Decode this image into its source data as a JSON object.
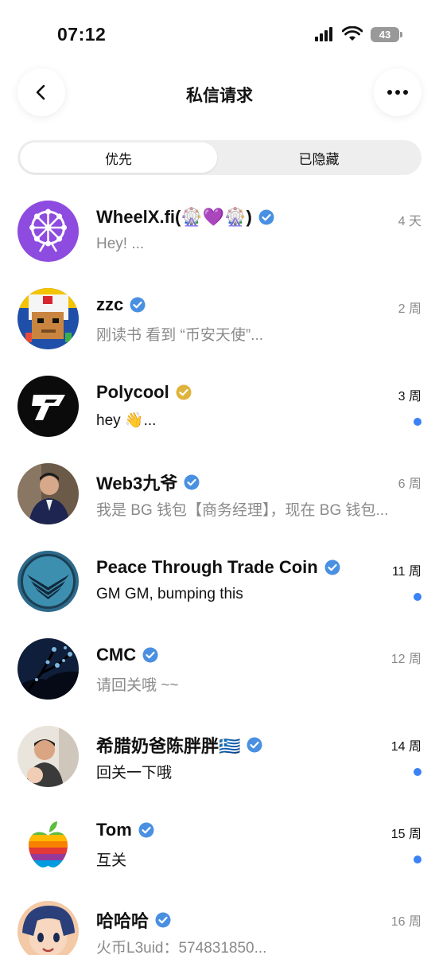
{
  "status": {
    "time": "07:12",
    "battery": "43"
  },
  "header": {
    "title": "私信请求"
  },
  "tabs": [
    {
      "label": "优先",
      "active": true
    },
    {
      "label": "已隐藏",
      "active": false
    }
  ],
  "conversations": [
    {
      "name": "WheelX.fi(🎡💜🎡)",
      "preview": "Hey! ...",
      "time": "4 天",
      "unread": false,
      "verified": "blue"
    },
    {
      "name": "zzc",
      "preview": "刚读书 看到 “币安天使”...",
      "time": "2 周",
      "unread": false,
      "verified": "blue"
    },
    {
      "name": "Polycool",
      "preview": "hey 👋...",
      "time": "3 周",
      "unread": true,
      "verified": "gold"
    },
    {
      "name": "Web3九爷",
      "preview": "我是 BG 钱包【商务经理】，现在 BG 钱包...",
      "time": "6 周",
      "unread": false,
      "verified": "blue"
    },
    {
      "name": "Peace Through Trade Coin",
      "preview": "GM GM, bumping this",
      "time": "11 周",
      "unread": true,
      "verified": "blue"
    },
    {
      "name": "CMC",
      "preview": "请回关哦 ~~",
      "time": "12 周",
      "unread": false,
      "verified": "blue"
    },
    {
      "name": "希腊奶爸陈胖胖🇬🇷",
      "preview": "回关一下哦",
      "time": "14 周",
      "unread": true,
      "verified": "blue"
    },
    {
      "name": "Tom",
      "preview": "互关",
      "time": "15 周",
      "unread": true,
      "verified": "blue"
    },
    {
      "name": "哈哈哈",
      "preview": "火币L3uid：574831850...",
      "time": "16 周",
      "unread": false,
      "verified": "blue"
    }
  ],
  "colors": {
    "accent_blue": "#3b82f6",
    "verified_blue": "#4a90e2",
    "verified_gold": "#e0b43c",
    "unread_dot": "#3b82f6"
  }
}
